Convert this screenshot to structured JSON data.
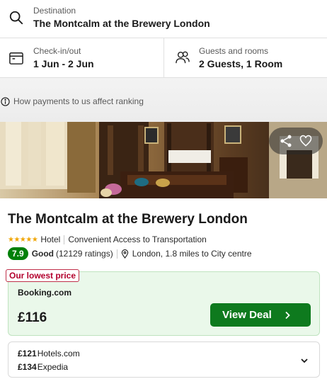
{
  "search": {
    "destination_label": "Destination",
    "destination_value": "The Montcalm at the Brewery London",
    "dates_label": "Check-in/out",
    "dates_value": "1 Jun - 2 Jun",
    "guests_label": "Guests and rooms",
    "guests_value": "2 Guests, 1 Room"
  },
  "info": {
    "payments_text": "How payments to us affect ranking"
  },
  "hotel": {
    "name": "The Montcalm at the Brewery London",
    "stars": "★★★★★",
    "type": "Hotel",
    "feature": "Convenient Access to Transportation",
    "score": "7.9",
    "rating_word": "Good",
    "rating_count": "(12129 ratings)",
    "location": "London, 1.8 miles to City centre"
  },
  "best_deal": {
    "tag": "Our lowest price",
    "provider": "Booking.com",
    "price": "£116",
    "button_label": "View Deal"
  },
  "other_deals": [
    {
      "price": "£121",
      "provider": "Hotels.com"
    },
    {
      "price": "£134",
      "provider": "Expedia"
    }
  ],
  "colors": {
    "accent_green": "#0e7a1e",
    "score_green": "#008009",
    "deal_bg": "#eaf8ea",
    "tag_red": "#b3002d"
  }
}
